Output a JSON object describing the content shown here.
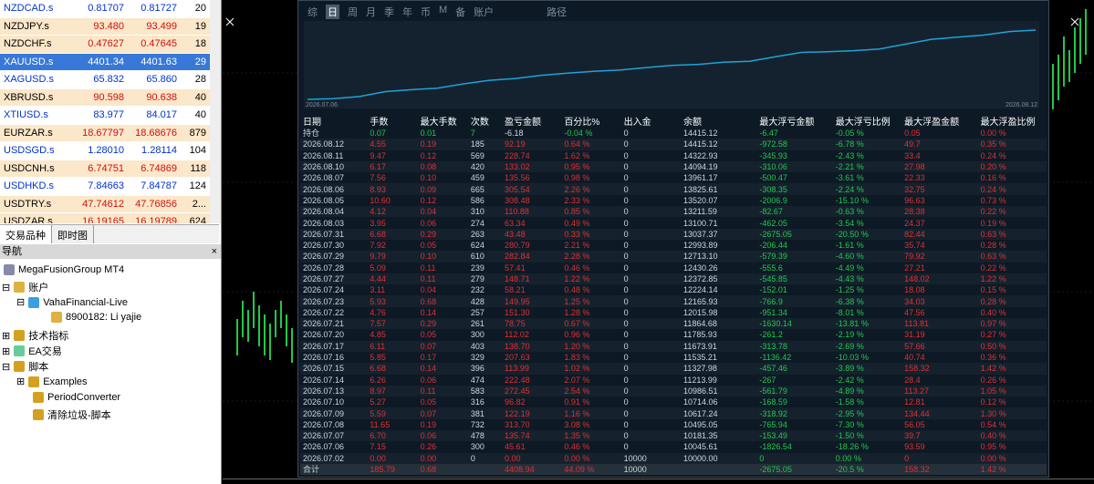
{
  "market_watch": {
    "rows": [
      {
        "symbol": "NZDCAD.s",
        "bid": "0.81707",
        "ask": "0.81727",
        "spread": "20",
        "style": "blue"
      },
      {
        "symbol": "NZDJPY.s",
        "bid": "93.480",
        "ask": "93.499",
        "spread": "19",
        "style": "red"
      },
      {
        "symbol": "NZDCHF.s",
        "bid": "0.47627",
        "ask": "0.47645",
        "spread": "18",
        "style": "red"
      },
      {
        "symbol": "XAUUSD.s",
        "bid": "4401.34",
        "ask": "4401.63",
        "spread": "29",
        "style": "sel"
      },
      {
        "symbol": "XAGUSD.s",
        "bid": "65.832",
        "ask": "65.860",
        "spread": "28",
        "style": "blue"
      },
      {
        "symbol": "XBRUSD.s",
        "bid": "90.598",
        "ask": "90.638",
        "spread": "40",
        "style": "red"
      },
      {
        "symbol": "XTIUSD.s",
        "bid": "83.977",
        "ask": "84.017",
        "spread": "40",
        "style": "blue"
      },
      {
        "symbol": "EURZAR.s",
        "bid": "18.67797",
        "ask": "18.68676",
        "spread": "879",
        "style": "red"
      },
      {
        "symbol": "USDSGD.s",
        "bid": "1.28010",
        "ask": "1.28114",
        "spread": "104",
        "style": "blue"
      },
      {
        "symbol": "USDCNH.s",
        "bid": "6.74751",
        "ask": "6.74869",
        "spread": "118",
        "style": "red"
      },
      {
        "symbol": "USDHKD.s",
        "bid": "7.84663",
        "ask": "7.84787",
        "spread": "124",
        "style": "blue"
      },
      {
        "symbol": "USDTRY.s",
        "bid": "47.74612",
        "ask": "47.76856",
        "spread": "2...",
        "style": "red"
      },
      {
        "symbol": "USDZAR.s",
        "bid": "16.19165",
        "ask": "16.19789",
        "spread": "624",
        "style": "red"
      }
    ]
  },
  "tabs": {
    "symbols": "交易品种",
    "tick_chart": "即时图"
  },
  "navigator": {
    "title": "导航",
    "root": "MegaFusionGroup MT4",
    "accounts": "账户",
    "server": "VahaFinancial-Live",
    "account": "8900182: Li yajie",
    "indicators": "技术指标",
    "experts": "EA交易",
    "scripts": "脚本",
    "examples": "Examples",
    "period_converter": "PeriodConverter",
    "cleanup": "清除垃圾-脚本"
  },
  "report": {
    "tabs": [
      "综",
      "日",
      "周",
      "月",
      "季",
      "年",
      "币",
      "M",
      "备",
      "账户",
      "",
      "路径"
    ],
    "active_tab": "日",
    "eq_start": "2026.07.06",
    "eq_end": "2026.08.12",
    "headers": [
      "日期",
      "手数",
      "最大手数",
      "次数",
      "盈亏金额",
      "百分比%",
      "出入金",
      "余额",
      "最大浮亏金额",
      "最大浮亏比例",
      "最大浮盈金额",
      "最大浮盈比例"
    ],
    "holding": [
      "持仓",
      "0.07",
      "0.01",
      "7",
      "-6.18",
      "-0.04 %",
      "0",
      "14415.12",
      "-6.47",
      "-0.05 %",
      "0.05",
      "0.00 %"
    ],
    "rows": [
      [
        "2026.08.12",
        "4.55",
        "0.19",
        "185",
        "92.19",
        "0.64 %",
        "0",
        "14415.12",
        "-972.58",
        "-6.78 %",
        "49.7",
        "0.35 %"
      ],
      [
        "2026.08.11",
        "9.47",
        "0.12",
        "569",
        "228.74",
        "1.62 %",
        "0",
        "14322.93",
        "-345.93",
        "-2.43 %",
        "33.4",
        "0.24 %"
      ],
      [
        "2026.08.10",
        "6.17",
        "0.08",
        "420",
        "133.02",
        "0.95 %",
        "0",
        "14094.19",
        "-310.06",
        "-2.21 %",
        "27.98",
        "0.20 %"
      ],
      [
        "2026.08.07",
        "7.56",
        "0.10",
        "459",
        "135.56",
        "0.98 %",
        "0",
        "13961.17",
        "-500.47",
        "-3.61 %",
        "22.33",
        "0.16 %"
      ],
      [
        "2026.08.06",
        "8.93",
        "0.09",
        "665",
        "305.54",
        "2.26 %",
        "0",
        "13825.61",
        "-308.35",
        "-2.24 %",
        "32.75",
        "0.24 %"
      ],
      [
        "2026.08.05",
        "10.60",
        "0.12",
        "586",
        "308.48",
        "2.33 %",
        "0",
        "13520.07",
        "-2006.9",
        "-15.10 %",
        "96.63",
        "0.73 %"
      ],
      [
        "2026.08.04",
        "4.12",
        "0.04",
        "310",
        "110.88",
        "0.85 %",
        "0",
        "13211.59",
        "-82.67",
        "-0.63 %",
        "28.38",
        "0.22 %"
      ],
      [
        "2026.08.03",
        "3.95",
        "0.06",
        "274",
        "63.34",
        "0.49 %",
        "0",
        "13100.71",
        "-462.05",
        "-3.54 %",
        "24.37",
        "0.19 %"
      ],
      [
        "2026.07.31",
        "6.68",
        "0.29",
        "263",
        "43.48",
        "0.33 %",
        "0",
        "13037.37",
        "-2675.05",
        "-20.50 %",
        "82.44",
        "0.63 %"
      ],
      [
        "2026.07.30",
        "7.92",
        "0.05",
        "624",
        "280.79",
        "2.21 %",
        "0",
        "12993.89",
        "-206.44",
        "-1.61 %",
        "35.74",
        "0.28 %"
      ],
      [
        "2026.07.29",
        "9.79",
        "0.10",
        "610",
        "282.84",
        "2.28 %",
        "0",
        "12713.10",
        "-579.39",
        "-4.60 %",
        "79.92",
        "0.63 %"
      ],
      [
        "2026.07.28",
        "5.09",
        "0.11",
        "239",
        "57.41",
        "0.46 %",
        "0",
        "12430.26",
        "-555.6",
        "-4.49 %",
        "27.21",
        "0.22 %"
      ],
      [
        "2026.07.27",
        "4.44",
        "0.11",
        "279",
        "148.71",
        "1.22 %",
        "0",
        "12372.85",
        "-545.85",
        "-4.43 %",
        "148.02",
        "1.22 %"
      ],
      [
        "2026.07.24",
        "3.11",
        "0.04",
        "232",
        "58.21",
        "0.48 %",
        "0",
        "12224.14",
        "-152.01",
        "-1.25 %",
        "18.08",
        "0.15 %"
      ],
      [
        "2026.07.23",
        "5.93",
        "0.68",
        "428",
        "149.95",
        "1.25 %",
        "0",
        "12165.93",
        "-766.9",
        "-6.38 %",
        "34.03",
        "0.28 %"
      ],
      [
        "2026.07.22",
        "4.76",
        "0.14",
        "257",
        "151.30",
        "1.28 %",
        "0",
        "12015.98",
        "-951.34",
        "-8.01 %",
        "47.56",
        "0.40 %"
      ],
      [
        "2026.07.21",
        "7.57",
        "0.29",
        "261",
        "78.75",
        "0.67 %",
        "0",
        "11864.68",
        "-1630.14",
        "-13.81 %",
        "113.81",
        "0.97 %"
      ],
      [
        "2026.07.20",
        "4.85",
        "0.05",
        "300",
        "112.02",
        "0.96 %",
        "0",
        "11785.93",
        "-261.2",
        "-2.19 %",
        "31.19",
        "0.27 %"
      ],
      [
        "2026.07.17",
        "6.11",
        "0.07",
        "403",
        "138.70",
        "1.20 %",
        "0",
        "11673.91",
        "-313.78",
        "-2.69 %",
        "57.66",
        "0.50 %"
      ],
      [
        "2026.07.16",
        "5.85",
        "0.17",
        "329",
        "207.63",
        "1.83 %",
        "0",
        "11535.21",
        "-1136.42",
        "-10.03 %",
        "40.74",
        "0.36 %"
      ],
      [
        "2026.07.15",
        "6.68",
        "0.14",
        "396",
        "113.99",
        "1.02 %",
        "0",
        "11327.98",
        "-457.46",
        "-3.89 %",
        "158.32",
        "1.42 %"
      ],
      [
        "2026.07.14",
        "6.26",
        "0.06",
        "474",
        "222.48",
        "2.07 %",
        "0",
        "11213.99",
        "-267",
        "-2.42 %",
        "28.4",
        "0.26 %"
      ],
      [
        "2026.07.13",
        "8.97",
        "0.11",
        "583",
        "272.45",
        "2.54 %",
        "0",
        "10986.51",
        "-561.79",
        "-4.89 %",
        "113.27",
        "1.05 %"
      ],
      [
        "2026.07.10",
        "5.27",
        "0.05",
        "316",
        "96.82",
        "0.91 %",
        "0",
        "10714.06",
        "-168.59",
        "-1.58 %",
        "12.81",
        "0.12 %"
      ],
      [
        "2026.07.09",
        "5.59",
        "0.07",
        "381",
        "122.19",
        "1.16 %",
        "0",
        "10617.24",
        "-318.92",
        "-2.95 %",
        "134.44",
        "1.30 %"
      ],
      [
        "2026.07.08",
        "11.65",
        "0.19",
        "732",
        "313.70",
        "3.08 %",
        "0",
        "10495.05",
        "-765.94",
        "-7.30 %",
        "56.05",
        "0.54 %"
      ],
      [
        "2026.07.07",
        "6.70",
        "0.06",
        "478",
        "135.74",
        "1.35 %",
        "0",
        "10181.35",
        "-153.49",
        "-1.50 %",
        "39.7",
        "0.40 %"
      ],
      [
        "2026.07.06",
        "7.15",
        "0.26",
        "300",
        "45.61",
        "0.46 %",
        "0",
        "10045.61",
        "-1826.54",
        "-18.26 %",
        "93.59",
        "0.95 %"
      ],
      [
        "2026.07.02",
        "0.00",
        "0.00",
        "0",
        "0.00",
        "0.00 %",
        "10000",
        "10000.00",
        "0",
        "0.00 %",
        "0",
        "0.00 %"
      ]
    ],
    "total": [
      "合计",
      "185.79",
      "0.68",
      "",
      "4408.94",
      "44.09 %",
      "10000",
      "",
      "-2675.05",
      "-20.5 %",
      "158.32",
      "1.42 %"
    ]
  },
  "colors": {
    "neutral": "#cfd6dc",
    "loss": "#e03030",
    "gain": "#22c84a",
    "line": "#1fa3d6"
  }
}
